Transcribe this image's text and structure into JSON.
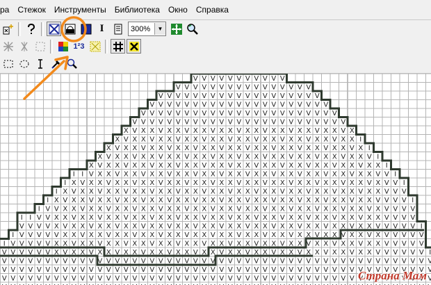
{
  "menubar": {
    "items": [
      "ра",
      "Стежок",
      "Инструменты",
      "Библиотека",
      "Окно",
      "Справка"
    ]
  },
  "toolbar": {
    "zoom_value": "300%",
    "stitch_label": "I",
    "numbers_label": "1²3"
  },
  "icons": {
    "toolbar1": [
      "sparkle-wand-icon",
      "help-question-icon",
      "cross-stitch-icon",
      "half-stitch-icon",
      "solid-block-icon",
      "backstitch-icon",
      "page-icon",
      "zoom-dropdown",
      "fit-view-icon",
      "zoom-search-icon"
    ],
    "toolbar2": [
      "tile-cross-icon",
      "delete-mark-icon",
      "select-box-icon",
      "color-palette-icon",
      "symbol-numbers-icon",
      "pattern-grid-icon",
      "grid-icon",
      "yellow-cross-icon"
    ],
    "toolbar3": [
      "rect-select-icon",
      "lasso-select-icon",
      "text-cursor-icon",
      "eyedropper-icon",
      "magnifier-icon"
    ]
  },
  "colors": {
    "accent_orange": "#f28a1c",
    "grid_line": "#b4b4b4",
    "grid_major": "#7f7f7f",
    "outline": "#2f3a2f",
    "watermark_red": "#c0392b"
  },
  "pattern": {
    "symbols": [
      "V",
      "X",
      "I"
    ]
  },
  "watermark": {
    "text": "Страна Мам"
  }
}
